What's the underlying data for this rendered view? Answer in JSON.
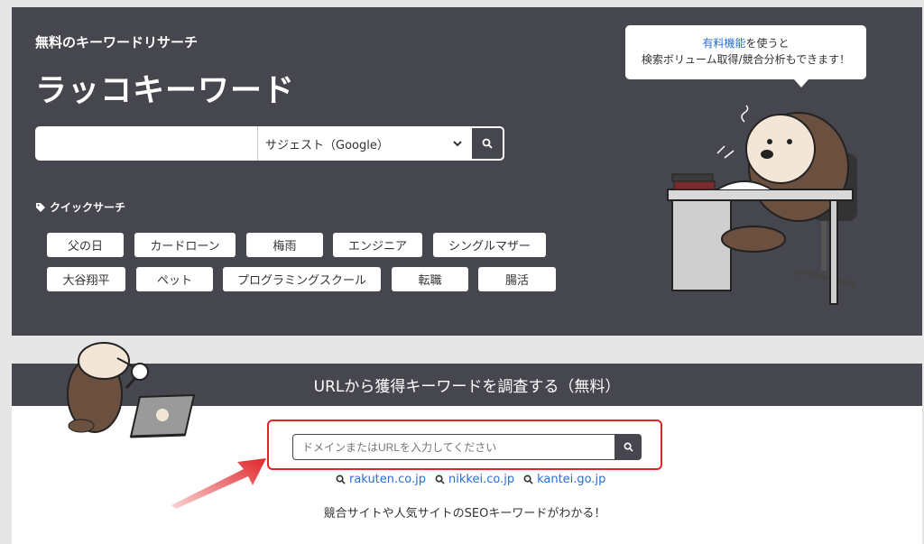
{
  "hero": {
    "subtitle": "無料のキーワードリサーチ",
    "title": "ラッコキーワード",
    "search": {
      "value": "",
      "engine": "サジェスト（Google）"
    },
    "quick_search_label": "クイックサーチ",
    "quick_search_items": [
      "父の日",
      "カードローン",
      "梅雨",
      "エンジニア",
      "シングルマザー",
      "大谷翔平",
      "ペット",
      "プログラミングスクール",
      "転職",
      "腸活"
    ]
  },
  "bubble": {
    "link": "有料機能",
    "line1_rest": "を使うと",
    "line2": "検索ボリューム取得/競合分析もできます！"
  },
  "url_section": {
    "heading": "URLから獲得キーワードを調査する（無料）",
    "placeholder": "ドメインまたはURLを入力してください",
    "examples": [
      "rakuten.co.jp",
      "nikkei.co.jp",
      "kantei.go.jp"
    ],
    "note": "競合サイトや人気サイトのSEOキーワードがわかる！"
  },
  "colors": {
    "dark": "#46464e",
    "accent_red": "#e0262a",
    "link": "#2a6fd1"
  }
}
